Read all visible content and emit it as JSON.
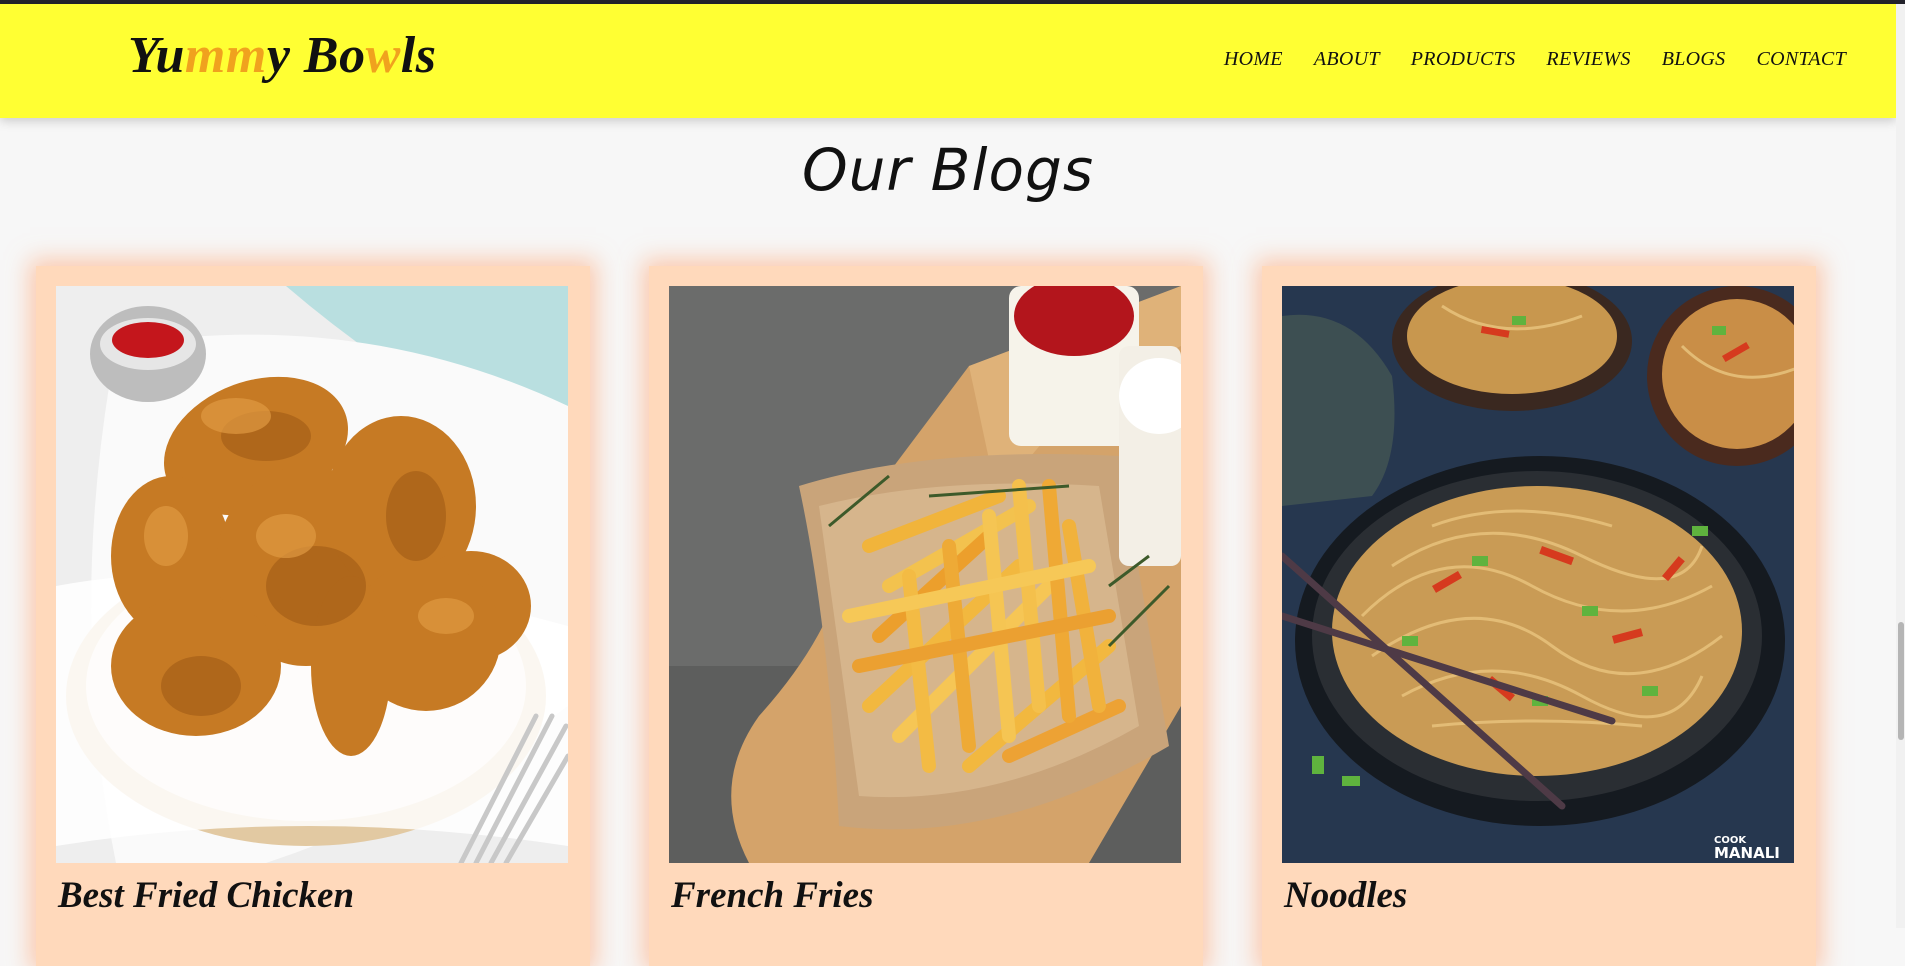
{
  "header": {
    "logo_parts": [
      "Yu",
      "mm",
      "y Bo",
      "w",
      "ls"
    ],
    "nav": [
      "HOME",
      "ABOUT",
      "PRODUCTS",
      "REVIEWS",
      "BLOGS",
      "CONTACT"
    ]
  },
  "colors": {
    "navbar": "#ffff33",
    "logo_accent": "#f0a21e",
    "card_bg": "#ffd9bb"
  },
  "blogs": {
    "title": "Our Blogs",
    "cards": [
      {
        "title": "Best Fried Chicken",
        "image": "fried-chicken-photo"
      },
      {
        "title": "French Fries",
        "image": "french-fries-photo"
      },
      {
        "title": "Noodles",
        "image": "noodles-photo",
        "watermark": "COOK MANALI"
      }
    ]
  }
}
